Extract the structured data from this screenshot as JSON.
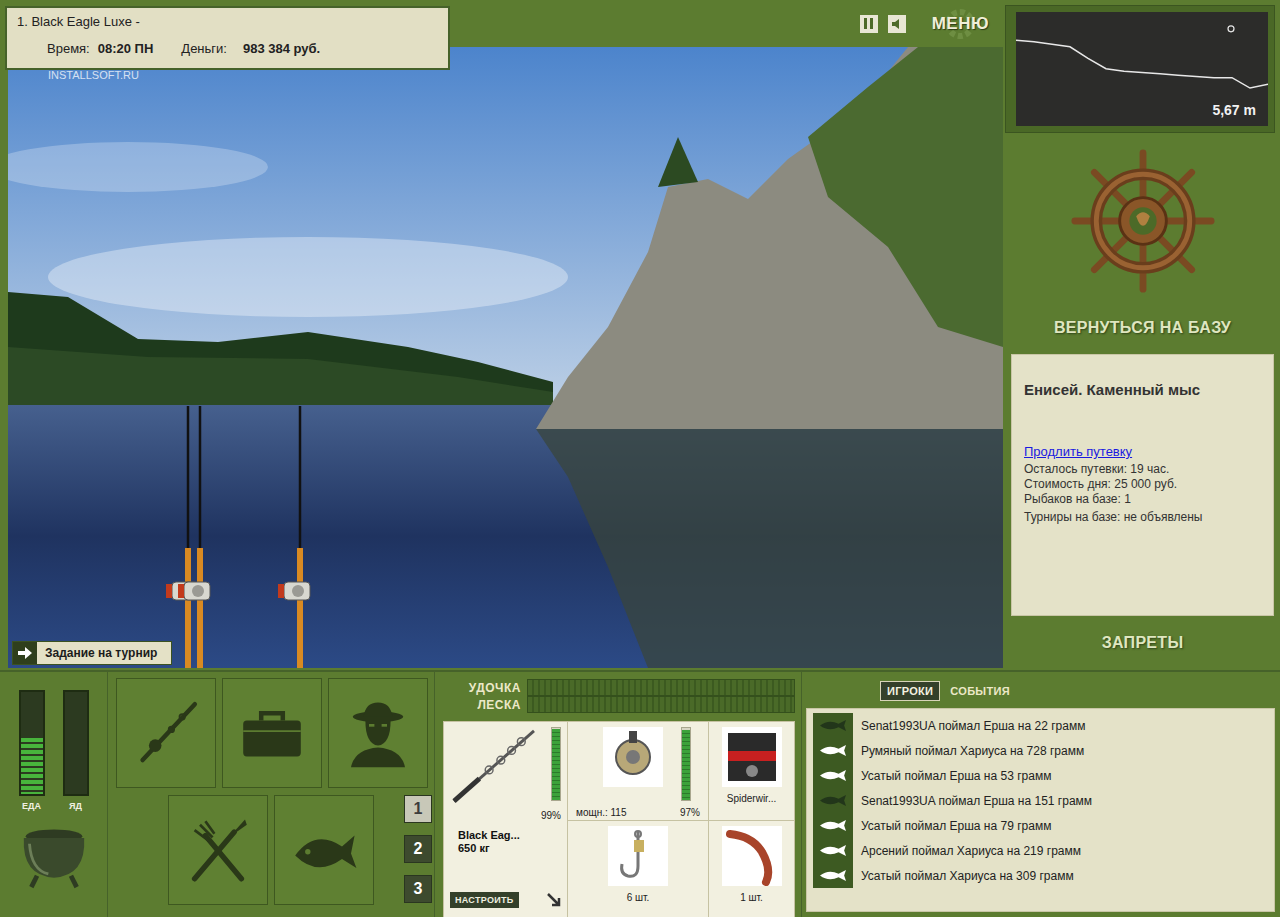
{
  "session": {
    "title": "1. Black Eagle Luxe -",
    "time_label": "Время:",
    "time": "08:20 ПН",
    "money_label": "Деньги:",
    "money": "983 384 руб."
  },
  "watermark": "INSTALLSOFT.RU",
  "menu_label": "МЕНЮ",
  "depth": {
    "reading": "5,67 m",
    "profile": [
      2.2,
      2.3,
      2.5,
      2.7,
      3.6,
      4.4,
      4.6,
      4.7,
      4.8,
      4.9,
      5.0,
      5.1,
      5.1,
      5.9,
      5.6
    ]
  },
  "base_button": "ВЕРНУТЬСЯ НА БАЗУ",
  "location": {
    "name": "Енисей. Каменный мыс",
    "extend_link": "Продлить путевку",
    "lines": [
      "Осталось путевки: 19 час.",
      "Стоимость дня: 25 000 руб.",
      "Рыбаков на базе: 1",
      "Турниры на базе: не объявлены"
    ]
  },
  "bans_button": "ЗАПРЕТЫ",
  "tournament_task": "Задание на турнир",
  "gauges": [
    {
      "label": "ЕДА",
      "level": 0.55
    },
    {
      "label": "ЯД",
      "level": 0
    }
  ],
  "rod_slots": [
    {
      "label": "1",
      "selected": true
    },
    {
      "label": "2",
      "selected": false
    },
    {
      "label": "3",
      "selected": false
    }
  ],
  "tension": [
    {
      "label": "УДОЧКА",
      "level": 0
    },
    {
      "label": "ЛЕСКА",
      "level": 0
    }
  ],
  "tackle": {
    "rod": {
      "name": "Black Eag...",
      "strength": "650 кг",
      "condition": "99%",
      "level": 0.99,
      "setup_button": "НАСТРОИТЬ"
    },
    "reel": {
      "power": "мощн.: 115",
      "condition": "97%",
      "level": 0.97
    },
    "line": {
      "name": "Spiderwir..."
    },
    "hook": {
      "count": "6 шт."
    },
    "bait": {
      "count": "1 шт."
    }
  },
  "feed": {
    "tabs": [
      {
        "label": "ИГРОКИ",
        "selected": true
      },
      {
        "label": "СОБЫТИЯ",
        "selected": false
      }
    ],
    "items": [
      {
        "text": "Senat1993UA поймал Ерша на 22 грамм",
        "color": "#22361a"
      },
      {
        "text": "Румяный поймал Хариуса на 728 грамм",
        "color": "#ffffff"
      },
      {
        "text": "Усатый поймал Ерша на 53 грамм",
        "color": "#ffffff"
      },
      {
        "text": "Senat1993UA поймал Ерша на 151 грамм",
        "color": "#22361a"
      },
      {
        "text": "Усатый поймал Ерша на 79 грамм",
        "color": "#ffffff"
      },
      {
        "text": "Арсений поймал Хариуса на 219 грамм",
        "color": "#ffffff"
      },
      {
        "text": "Усатый поймал Хариуса на 309 грамм",
        "color": "#ffffff"
      }
    ]
  }
}
